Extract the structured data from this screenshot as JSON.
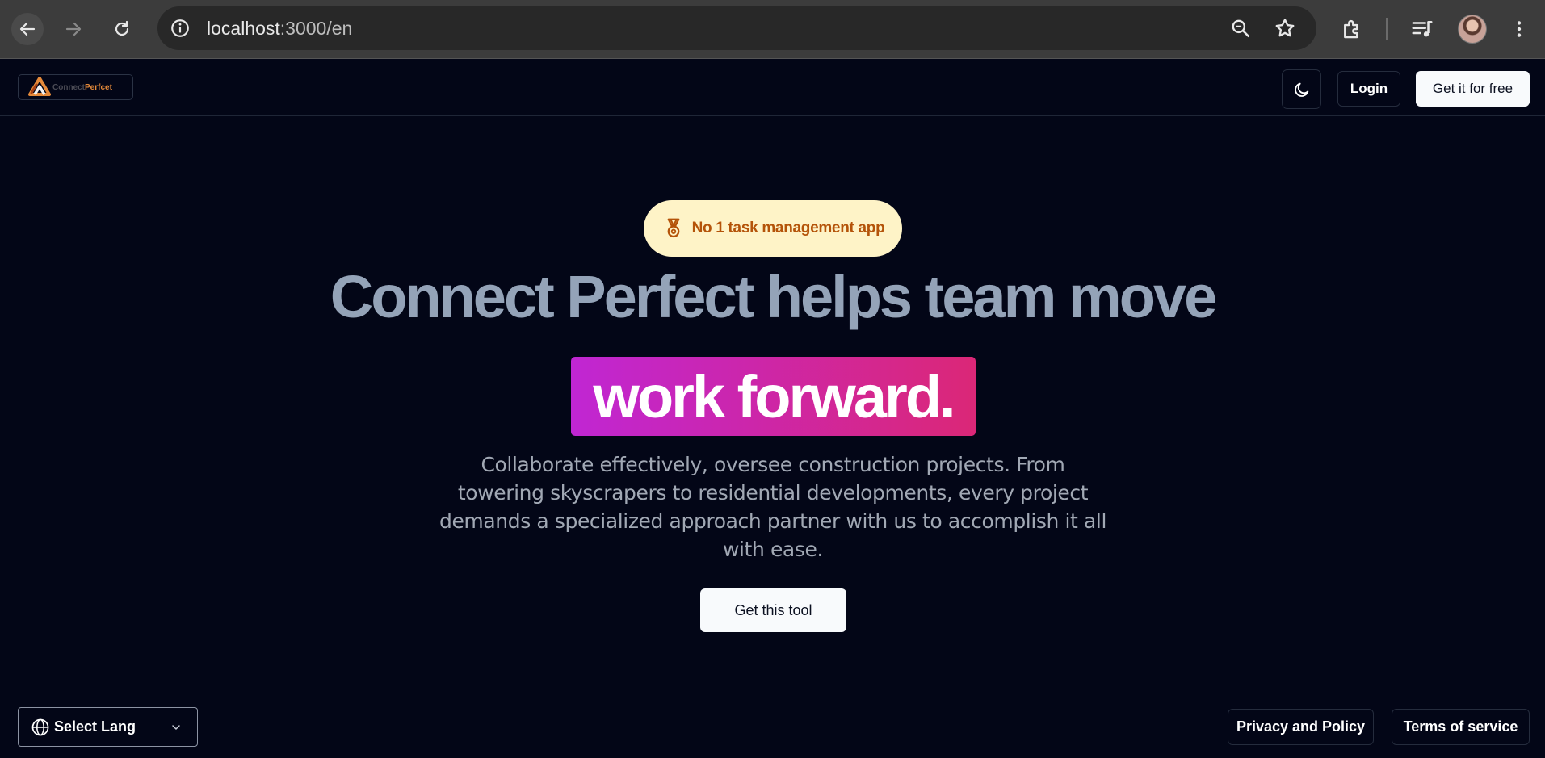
{
  "browser": {
    "url_host": "localhost",
    "url_path": ":3000/en",
    "icons": [
      "back-icon",
      "forward-icon",
      "reload-icon",
      "site-info-icon",
      "zoom-icon",
      "bookmark-star-icon",
      "extensions-icon",
      "media-queue-icon",
      "profile-avatar",
      "more-menu-icon"
    ]
  },
  "header": {
    "logo_text_1": "Connect",
    "logo_text_2": "Perfcet",
    "login_label": "Login",
    "cta_label": "Get it for free"
  },
  "hero": {
    "badge_label": "No 1 task management app",
    "headline": "Connect Perfect helps team move",
    "highlight": "work forward.",
    "description": "Collaborate effectively, oversee construction projects. From towering skyscrapers to residential developments, every project demands a specialized approach partner with us to accomplish it all with ease.",
    "button_label": "Get this tool"
  },
  "footer": {
    "lang_label": "Select Lang",
    "privacy_label": "Privacy and Policy",
    "terms_label": "Terms of service"
  },
  "colors": {
    "background": "#030617",
    "badge_bg": "#fef3c7",
    "badge_text": "#b45309",
    "highlight_start": "#c026d3",
    "highlight_end": "#db2777",
    "headline": "#94a3b8"
  }
}
